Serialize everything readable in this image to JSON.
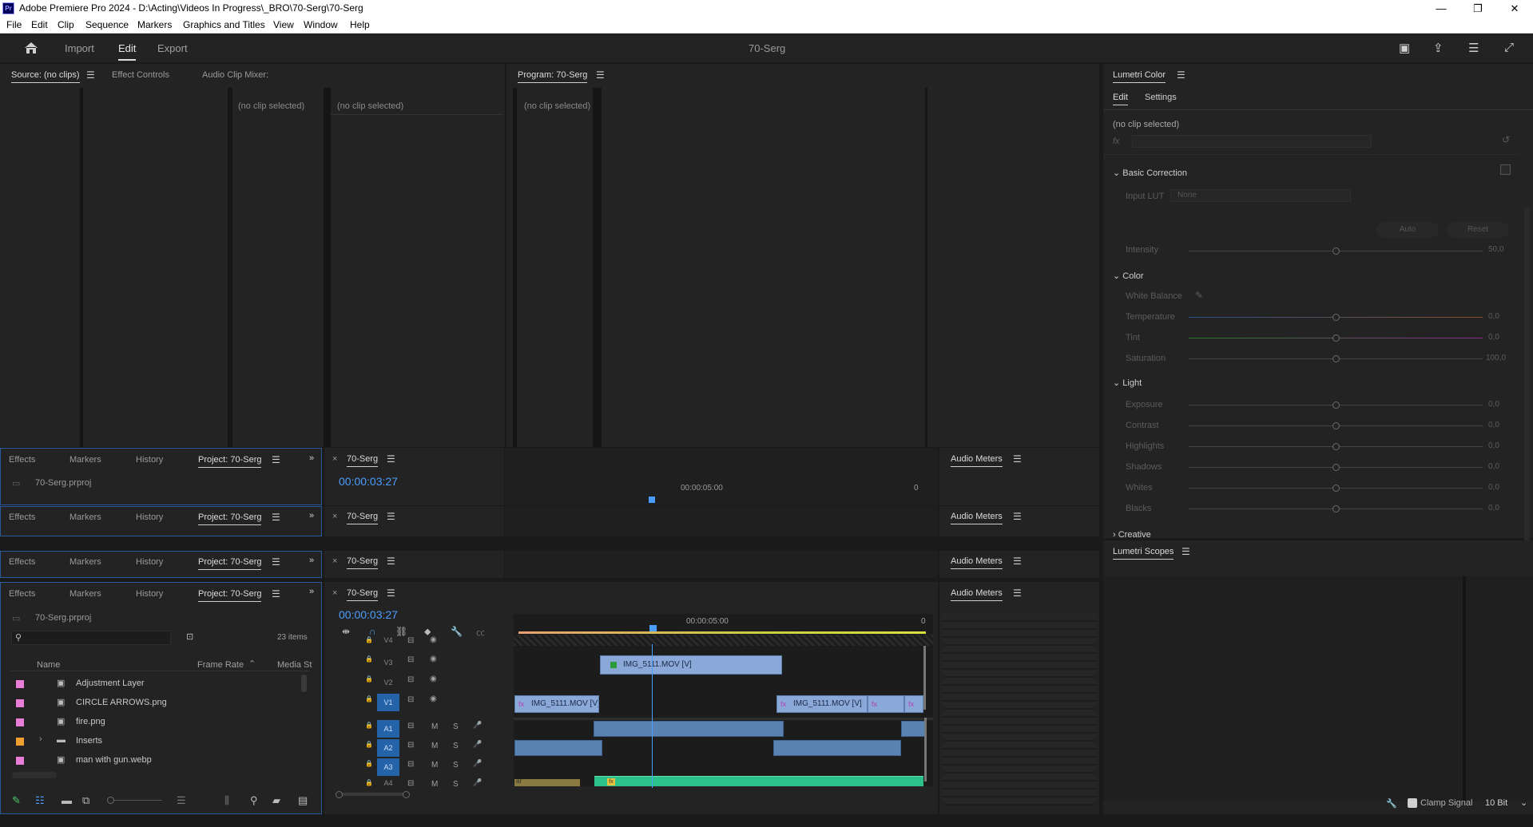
{
  "titlebar": {
    "app_icon": "Pr",
    "title": "Adobe Premiere Pro 2024 - D:\\Acting\\Videos In Progress\\_BRO\\70-Serg\\70-Serg",
    "minimize": "—",
    "maximize": "❐",
    "close": "✕"
  },
  "menu": [
    "File",
    "Edit",
    "Clip",
    "Sequence",
    "Markers",
    "Graphics and Titles",
    "View",
    "Window",
    "Help"
  ],
  "workspace": {
    "home_icon": "home-icon",
    "tabs": [
      "Import",
      "Edit",
      "Export"
    ],
    "active": "Edit",
    "project_title": "70-Serg"
  },
  "source_panel": {
    "tabs": [
      "Source: (no clips)",
      "Effect Controls",
      "Audio Clip Mixer:"
    ],
    "no_clip_1": "(no clip selected)",
    "no_clip_2": "(no clip selected)"
  },
  "program_panel": {
    "tab": "Program: 70-Serg",
    "no_clip": "(no clip selected)"
  },
  "lumetri_color": {
    "tab": "Lumetri Color",
    "subtabs": [
      "Edit",
      "Settings"
    ],
    "no_clip": "(no clip selected)",
    "fx": "fx",
    "basic_correction": "Basic Correction",
    "input_lut_label": "Input LUT",
    "input_lut_value": "None",
    "auto": "Auto",
    "reset": "Reset",
    "intensity": {
      "label": "Intensity",
      "value": "50,0"
    },
    "color_section": "Color",
    "white_balance": "White Balance",
    "color_sliders": [
      {
        "label": "Temperature",
        "value": "0,0"
      },
      {
        "label": "Tint",
        "value": "0,0"
      },
      {
        "label": "Saturation",
        "value": "100,0"
      }
    ],
    "light_section": "Light",
    "light_sliders": [
      {
        "label": "Exposure",
        "value": "0,0"
      },
      {
        "label": "Contrast",
        "value": "0,0"
      },
      {
        "label": "Highlights",
        "value": "0,0"
      },
      {
        "label": "Shadows",
        "value": "0,0"
      },
      {
        "label": "Whites",
        "value": "0,0"
      },
      {
        "label": "Blacks",
        "value": "0,0"
      }
    ],
    "creative_section": "Creative"
  },
  "lumetri_scopes": {
    "tab": "Lumetri Scopes",
    "clamp_signal": "Clamp Signal",
    "bit_depth": "10 Bit"
  },
  "project_stack": [
    {
      "tabs": [
        "Effects",
        "Markers",
        "History",
        "Project: 70-Serg"
      ],
      "file": "70-Serg.prproj"
    },
    {
      "tabs": [
        "Effects",
        "Markers",
        "History",
        "Project: 70-Serg"
      ]
    },
    {
      "tabs": [
        "Effects",
        "Markers",
        "History",
        "Project: 70-Serg"
      ]
    },
    {
      "tabs": [
        "Effects",
        "Markers",
        "History",
        "Project: 70-Serg"
      ],
      "file": "70-Serg.prproj",
      "items_count": "23 items",
      "columns": [
        "Name",
        "Frame Rate",
        "Media St"
      ],
      "items": [
        {
          "name": "Adjustment Layer",
          "color": "#e87ed8",
          "type": "file"
        },
        {
          "name": "CIRCLE ARROWS.png",
          "color": "#e87ed8",
          "type": "file"
        },
        {
          "name": "fire.png",
          "color": "#e87ed8",
          "type": "file"
        },
        {
          "name": "Inserts",
          "color": "#f0a030",
          "type": "folder"
        },
        {
          "name": "man with gun.webp",
          "color": "#e87ed8",
          "type": "file"
        }
      ]
    }
  ],
  "timeline": {
    "close": "×",
    "name": "70-Serg",
    "timecode": "00:00:03:27",
    "ruler_label": "00:00:05:00",
    "ruler_end": "0",
    "video_tracks": [
      "V4",
      "V3",
      "V2",
      "V1"
    ],
    "audio_tracks": [
      "A1",
      "A2",
      "A3",
      "A4"
    ],
    "clips": {
      "v3": "IMG_5111.MOV [V]",
      "v1a": "IMG_5111.MOV [V]",
      "v1b": "IMG_5111.MOV [V]"
    },
    "a4_label": "ar"
  },
  "audio_meters": "Audio Meters",
  "track_buttons": {
    "m": "M",
    "s": "S"
  }
}
